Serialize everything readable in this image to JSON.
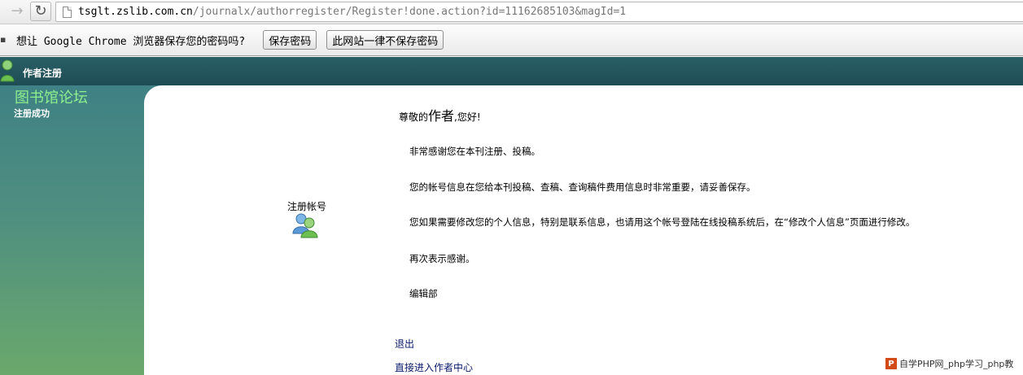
{
  "browser": {
    "forward_icon": "→",
    "reload_icon": "↻",
    "url_host": "tsglt.zslib.com.cn",
    "url_path": "/journalx/authorregister/Register!done.action?id=11162685103&magId=1"
  },
  "infobar": {
    "message": "想让 Google Chrome 浏览器保存您的密码吗?",
    "save_button": "保存密码",
    "never_button": "此网站一律不保存密码"
  },
  "header": {
    "title": "作者注册"
  },
  "sidebar": {
    "forum_title": "图书馆论坛",
    "status": "注册成功"
  },
  "main": {
    "account_label": "注册帐号",
    "greeting_prefix": "尊敬的",
    "greeting_name": "作者",
    "greeting_suffix": ",您好!",
    "paragraphs": [
      "非常感谢您在本刊注册、投稿。",
      "您的帐号信息在您给本刊投稿、查稿、查询稿件费用信息时非常重要，请妥善保存。",
      "您如果需要修改您的个人信息，特别是联系信息，也请用这个帐号登陆在线投稿系统后，在“修改个人信息”页面进行修改。",
      "再次表示感谢。",
      " 编辑部"
    ],
    "logout_link": "退出",
    "author_center_link": "直接进入作者中心"
  },
  "watermark": {
    "logo": "P",
    "text": "自学PHP网_php学习_php教"
  },
  "colors": {
    "header_bg": "#2a5f66",
    "sidebar_top": "#3f8184",
    "sidebar_bottom": "#6aa86c",
    "forum_title": "#8ef08e",
    "link": "#0a1a6c"
  }
}
